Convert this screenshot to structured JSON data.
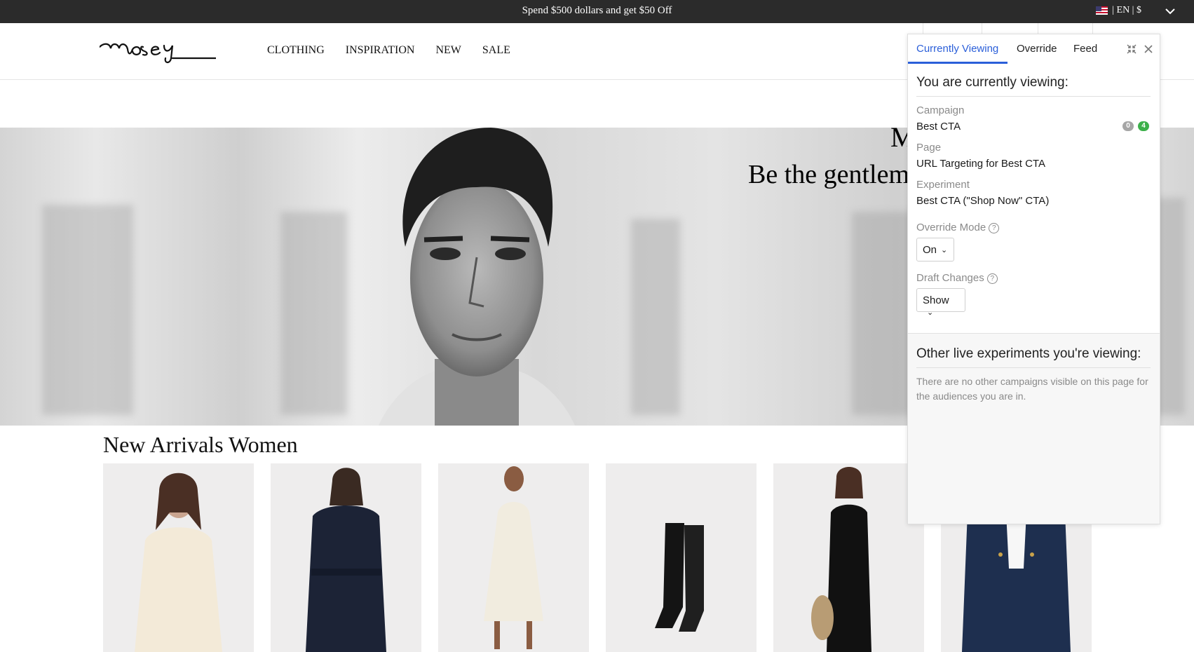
{
  "promo_bar": {
    "message": "Spend $500 dollars and get $50 Off",
    "locale": "| EN | $",
    "flag_icon": "us-flag-icon",
    "chevron_icon": "chevron-down-icon"
  },
  "header": {
    "logo_text": "mosey",
    "nav": [
      "CLOTHING",
      "INSPIRATION",
      "NEW",
      "SALE"
    ]
  },
  "hero": {
    "title": "M",
    "subtitle": "Be the gentlema"
  },
  "new_arrivals": {
    "title": "New Arrivals Women",
    "products": [
      "cream-shirt",
      "navy-belted-coat",
      "cream-halter-dress",
      "black-knee-boots",
      "black-tank-jumpsuit",
      "denim-jacket"
    ]
  },
  "panel": {
    "tabs": [
      "Currently Viewing",
      "Override",
      "Feed"
    ],
    "active_tab": "Currently Viewing",
    "heading": "You are currently viewing:",
    "campaign_label": "Campaign",
    "campaign_value": "Best CTA",
    "badges": [
      "0",
      "4"
    ],
    "page_label": "Page",
    "page_value": "URL Targeting for Best CTA",
    "experiment_label": "Experiment",
    "experiment_value": "Best CTA (\"Shop Now\" CTA)",
    "override_label": "Override Mode",
    "override_value": "On",
    "draft_label": "Draft Changes",
    "draft_value": "Show",
    "help_glyph": "?",
    "other_heading": "Other live experiments you're viewing:",
    "other_text": "There are no other campaigns visible on this page for the audiences you are in.",
    "colors": {
      "accent": "#2b5fd9",
      "badge_gray": "#a6a6a6",
      "badge_green": "#3cb04a"
    }
  }
}
